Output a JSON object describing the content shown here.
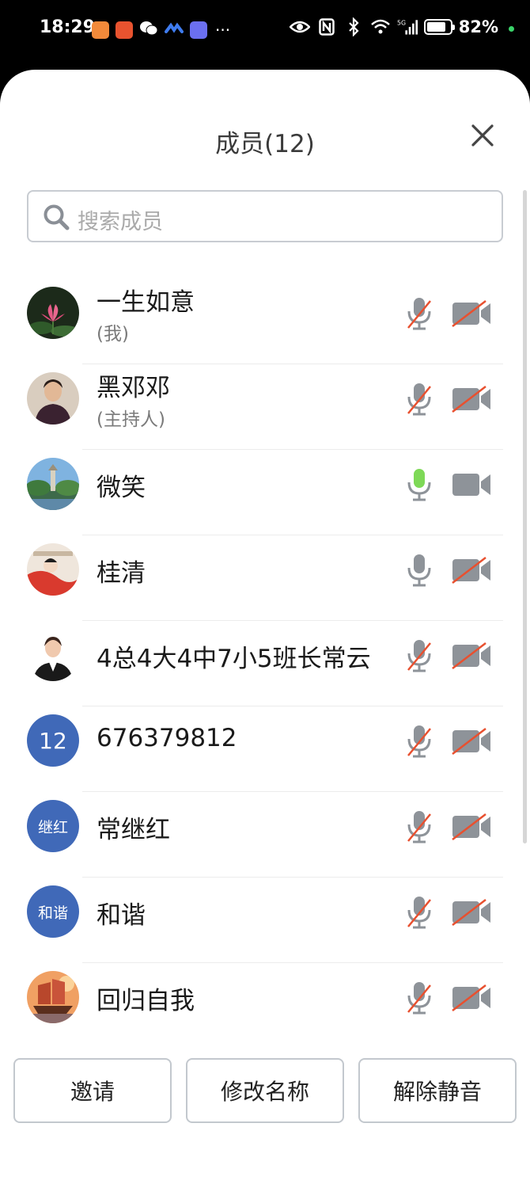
{
  "status_bar": {
    "time": "18:29",
    "battery": "82%",
    "network": "5G",
    "app_icons": [
      "taobao-icon",
      "jd-icon",
      "wechat-icon",
      "meeting-icon",
      "message-icon"
    ],
    "colors": {
      "accent_green": "#3ad46a"
    }
  },
  "header": {
    "title": "成员(12)"
  },
  "search": {
    "placeholder": "搜索成员"
  },
  "members": [
    {
      "name": "一生如意",
      "role": "(我)",
      "mic": "muted",
      "camera": "off",
      "avatar": "photo-lotus"
    },
    {
      "name": "黑邓邓",
      "role": "(主持人)",
      "mic": "muted",
      "camera": "off",
      "avatar": "photo-woman"
    },
    {
      "name": "微笑",
      "role": "",
      "mic": "active",
      "camera": "on",
      "avatar": "photo-pagoda"
    },
    {
      "name": "桂清",
      "role": "",
      "mic": "on",
      "camera": "off",
      "avatar": "photo-painting"
    },
    {
      "name": "4总4大4中7小5班长常云",
      "role": "",
      "mic": "muted",
      "camera": "off",
      "avatar": "photo-portrait"
    },
    {
      "name": "676379812",
      "role": "",
      "mic": "muted",
      "camera": "off",
      "avatar": "text",
      "avatar_text": "12"
    },
    {
      "name": "常继红",
      "role": "",
      "mic": "muted",
      "camera": "off",
      "avatar": "text",
      "avatar_text": "继红"
    },
    {
      "name": "和谐",
      "role": "",
      "mic": "muted",
      "camera": "off",
      "avatar": "text",
      "avatar_text": "和谐"
    },
    {
      "name": "回归自我",
      "role": "",
      "mic": "muted",
      "camera": "off",
      "avatar": "photo-ship"
    }
  ],
  "footer": {
    "invite": "邀请",
    "rename": "修改名称",
    "unmute": "解除静音"
  },
  "colors": {
    "avatar_blue": "#4069b8",
    "mute_red": "#e8502f",
    "mic_active_green": "#7ed957",
    "icon_gray": "#8e9399"
  }
}
